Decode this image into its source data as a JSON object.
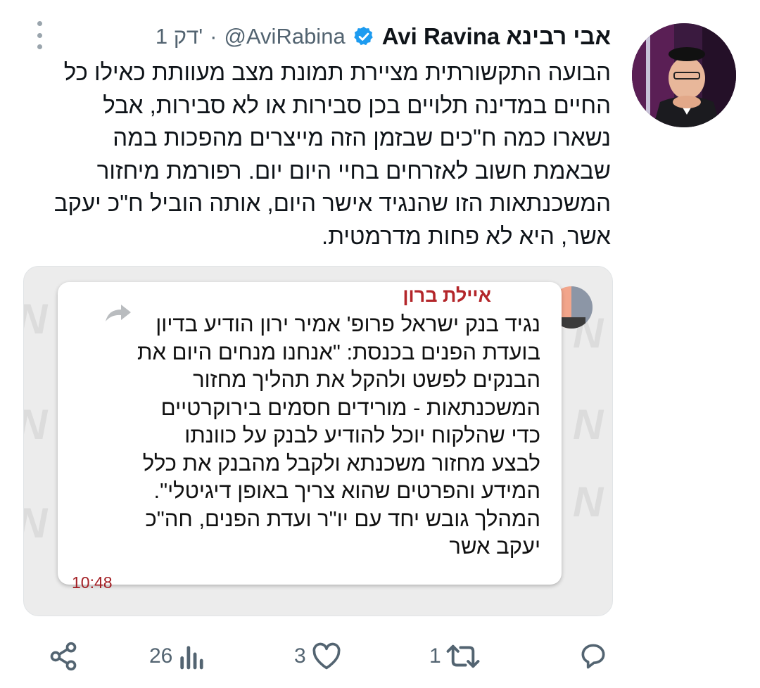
{
  "tweet": {
    "display_name": "Avi Ravina אבי רבינא",
    "handle": "@AviRabina",
    "separator": "·",
    "time": "1 דק'",
    "text_lines": [
      "הבועה התקשורתית מציירת תמונת מצב מעוותת כאילו כל",
      "החיים במדינה תלויים בכן סבירות או לא סבירות, אבל",
      "נשארו כמה ח\"כים שבזמן הזה מייצרים מהפכות במה",
      "שבאמת חשוב לאזרחים בחיי היום יום. רפורמת מיחזור",
      "המשכנתאות הזו שהנגיד אישר היום, אותה הוביל ח\"כ יעקב",
      "אשר, היא לא פחות מדרמטית."
    ]
  },
  "media": {
    "sender": "איילת ברון",
    "body_lines": [
      "נגיד בנק ישראל פרופ' אמיר ירון הודיע בדיון",
      "בועדת הפנים בכנסת: \"אנחנו מנחים היום את",
      "הבנקים לפשט ולהקל את תהליך מחזור",
      "המשכנתאות - מורידים חסמים בירוקרטיים",
      "כדי שהלקוח יוכל להודיע לבנק על כוונתו",
      "לבצע מחזור משכנתא ולקבל מהבנק את כלל",
      "המידע והפרטים שהוא צריך באופן דיגיטלי\".",
      "המהלך גובש יחד עם יו\"ר ועדת הפנים, חה\"כ",
      "יעקב אשר"
    ],
    "message_time": "10:48"
  },
  "actions": {
    "views": "26",
    "likes": "3",
    "retweets": "1",
    "icons": [
      "share-icon",
      "views-icon",
      "like-icon",
      "retweet-icon",
      "reply-icon"
    ]
  },
  "colors": {
    "text": "#0f1419",
    "secondary": "#536471",
    "verified": "#1d9bf0",
    "sender": "#b3262a"
  }
}
